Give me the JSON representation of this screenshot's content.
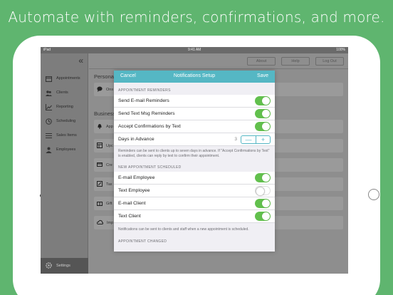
{
  "headline": "Automate with reminders, confirmations, and more.",
  "status_bar": {
    "device": "iPad",
    "time": "9:41 AM",
    "battery": "100%"
  },
  "sidebar": {
    "collapse_icon": "double-chevron-left",
    "items": [
      {
        "label": "Appointments",
        "icon": "calendar-icon"
      },
      {
        "label": "Clients",
        "icon": "people-icon"
      },
      {
        "label": "Reporting",
        "icon": "chart-icon"
      },
      {
        "label": "Scheduling",
        "icon": "clock-icon"
      },
      {
        "label": "Sales Items",
        "icon": "list-icon"
      },
      {
        "label": "Employees",
        "icon": "employees-icon"
      }
    ],
    "settings_label": "Settings"
  },
  "topbar": {
    "about": "About",
    "help": "Help",
    "logout": "Log Out"
  },
  "main": {
    "section_personal": "Personal",
    "section_business": "Business",
    "rows": [
      "Ons",
      "App",
      "Upc",
      "Cre",
      "Tax",
      "Gift",
      "Imp"
    ]
  },
  "modal": {
    "cancel": "Cancel",
    "title": "Notifications Setup",
    "save": "Save",
    "group1_label": "APPOINTMENT REMINDERS",
    "group1": [
      {
        "label": "Send E-mail Reminders",
        "on": true
      },
      {
        "label": "Send Text Msg Reminders",
        "on": true
      },
      {
        "label": "Accept Confirmations by Text",
        "on": true
      }
    ],
    "days_label": "Days in Advance",
    "days_value": "3",
    "stepper_minus": "—",
    "stepper_plus": "+",
    "group1_note": "Reminders can be sent to clients up to seven days in advance. If \"Accept Confirmations by Text\" is enabled, clients can reply by text to confirm their appointment.",
    "group2_label": "NEW APPOINTMENT SCHEDULED",
    "group2": [
      {
        "label": "E-mail Employee",
        "on": true
      },
      {
        "label": "Text Employee",
        "on": false
      },
      {
        "label": "E-mail Client",
        "on": true
      },
      {
        "label": "Text Client",
        "on": true
      }
    ],
    "group2_note": "Notifications can be sent to clients and staff when a new appointment is scheduled.",
    "group3_label": "APPOINTMENT CHANGED"
  },
  "colors": {
    "background": "#5fb56f",
    "accent": "#55b7c4",
    "toggle_on": "#62c04d"
  }
}
